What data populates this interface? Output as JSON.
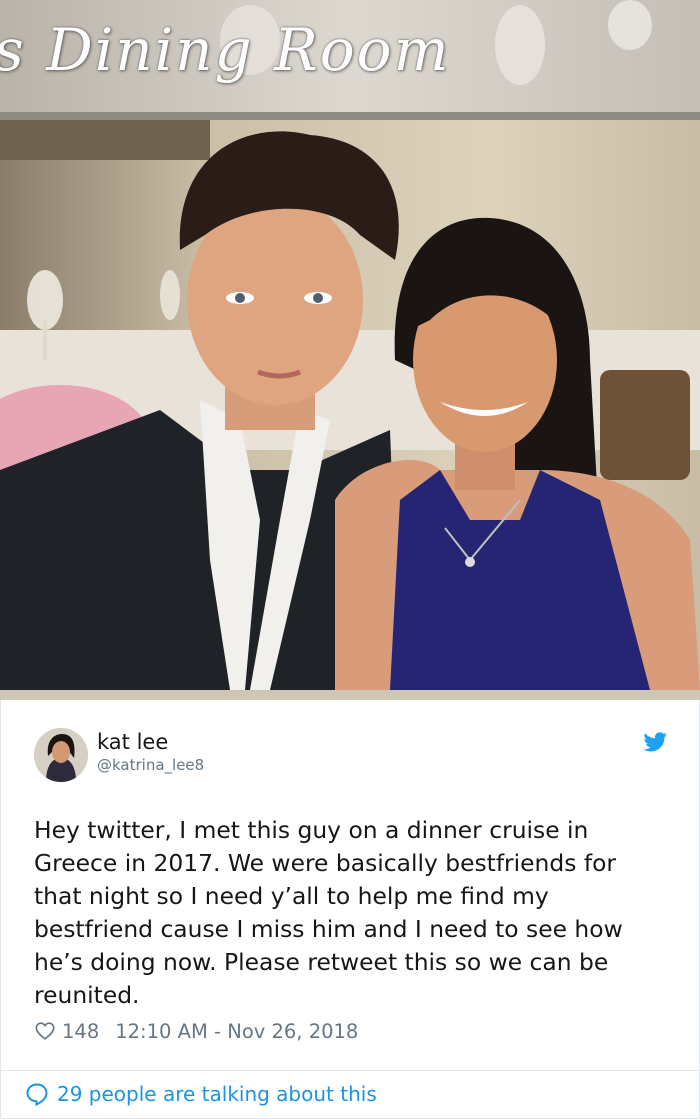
{
  "photo": {
    "banner_text": "s Dining Room"
  },
  "tweet": {
    "author_name": "kat lee",
    "author_handle": "@katrina_lee8",
    "text_lines": [
      "Hey twitter, I met this guy on a dinner cruise in",
      "Greece in 2017. We were basically bestfriends for",
      "that night so I need y’all to help me find my",
      "bestfriend cause I miss him and I need to see how",
      "he’s doing now. Please retweet this so we can be",
      "reunited."
    ],
    "like_count": "148",
    "timestamp": "12:10 AM - Nov 26, 2018",
    "talking_text": "29 people are talking about this"
  },
  "icons": {
    "brand": "twitter-bird-icon",
    "like": "heart-icon",
    "reply": "speech-bubble-icon"
  },
  "colors": {
    "twitter_blue": "#1da1f2",
    "link_blue": "#1b95e0",
    "meta_gray": "#657786",
    "text": "#14171a"
  }
}
